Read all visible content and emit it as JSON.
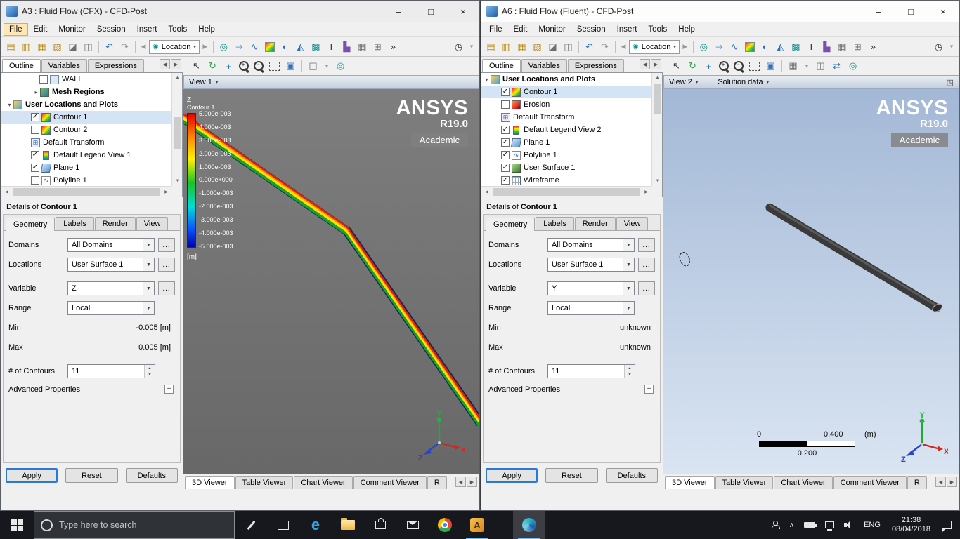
{
  "left_window": {
    "title": "A3 : Fluid Flow (CFX) - CFD-Post",
    "menu": [
      "File",
      "Edit",
      "Monitor",
      "Session",
      "Insert",
      "Tools",
      "Help"
    ],
    "toolbar": {
      "location_label": "Location"
    },
    "panel_tabs": [
      "Outline",
      "Variables",
      "Expressions"
    ],
    "tree": {
      "items": [
        {
          "label": "WALL"
        },
        {
          "label": "Mesh Regions"
        },
        {
          "label": "User Locations and Plots"
        },
        {
          "label": "Contour 1"
        },
        {
          "label": "Contour 2"
        },
        {
          "label": "Default Transform"
        },
        {
          "label": "Default Legend View 1"
        },
        {
          "label": "Plane 1"
        },
        {
          "label": "Polyline 1"
        }
      ]
    },
    "details": {
      "header_prefix": "Details of",
      "header_name": "Contour 1",
      "tabs": [
        "Geometry",
        "Labels",
        "Render",
        "View"
      ],
      "domains_label": "Domains",
      "domains_value": "All Domains",
      "locations_label": "Locations",
      "locations_value": "User Surface 1",
      "variable_label": "Variable",
      "variable_value": "Z",
      "range_label": "Range",
      "range_value": "Local",
      "min_label": "Min",
      "min_value": "-0.005 [m]",
      "max_label": "Max",
      "max_value": "0.005 [m]",
      "contours_label": "# of Contours",
      "contours_value": "11",
      "advanced_label": "Advanced Properties",
      "more_label": "...",
      "apply": "Apply",
      "reset": "Reset",
      "defaults": "Defaults"
    },
    "viewer": {
      "view_label": "View 1",
      "legend": {
        "variable": "Z",
        "name": "Contour 1",
        "values": [
          "5.000e-003",
          "4.000e-003",
          "3.000e-003",
          "2.000e-003",
          "1.000e-003",
          "0.000e+000",
          "-1.000e-003",
          "-2.000e-003",
          "-3.000e-003",
          "-4.000e-003",
          "-5.000e-003"
        ],
        "unit": "[m]"
      },
      "brand": {
        "name": "ANSYS",
        "version": "R19.0",
        "edition": "Academic"
      },
      "triad": {
        "x": "X",
        "y": "Y",
        "z": "Z"
      },
      "tabs": [
        "3D Viewer",
        "Table Viewer",
        "Chart Viewer",
        "Comment Viewer",
        "R"
      ]
    }
  },
  "right_window": {
    "title": "A6 : Fluid Flow (Fluent) - CFD-Post",
    "menu": [
      "File",
      "Edit",
      "Monitor",
      "Session",
      "Insert",
      "Tools",
      "Help"
    ],
    "toolbar": {
      "location_label": "Location"
    },
    "panel_tabs": [
      "Outline",
      "Variables",
      "Expressions"
    ],
    "tree": {
      "items": [
        {
          "label": "User Locations and Plots"
        },
        {
          "label": "Contour 1"
        },
        {
          "label": "Erosion"
        },
        {
          "label": "Default Transform"
        },
        {
          "label": "Default Legend View 2"
        },
        {
          "label": "Plane 1"
        },
        {
          "label": "Polyline 1"
        },
        {
          "label": "User Surface 1"
        },
        {
          "label": "Wireframe"
        }
      ]
    },
    "details": {
      "header_prefix": "Details of",
      "header_name": "Contour 1",
      "tabs": [
        "Geometry",
        "Labels",
        "Render",
        "View"
      ],
      "domains_label": "Domains",
      "domains_value": "All Domains",
      "locations_label": "Locations",
      "locations_value": "User Surface 1",
      "variable_label": "Variable",
      "variable_value": "Y",
      "range_label": "Range",
      "range_value": "Local",
      "min_label": "Min",
      "min_value": "unknown",
      "max_label": "Max",
      "max_value": "unknown",
      "contours_label": "# of Contours",
      "contours_value": "11",
      "advanced_label": "Advanced Properties",
      "more_label": "...",
      "apply": "Apply",
      "reset": "Reset",
      "defaults": "Defaults"
    },
    "viewer": {
      "view_label": "View 2",
      "data_label": "Solution data",
      "brand": {
        "name": "ANSYS",
        "version": "R19.0",
        "edition": "Academic"
      },
      "scale": {
        "zero": "0",
        "max": "0.400",
        "unit": "(m)",
        "mid": "0.200"
      },
      "triad": {
        "x": "X",
        "y": "Y",
        "z": "Z"
      },
      "tabs": [
        "3D Viewer",
        "Table Viewer",
        "Chart Viewer",
        "Comment Viewer",
        "R"
      ]
    }
  },
  "taskbar": {
    "search_placeholder": "Type here to search",
    "language": "ENG",
    "time": "21:38",
    "date": "08/04/2018"
  },
  "icons": {
    "minimize": "–",
    "maximize": "□",
    "close": "×",
    "doc_a": "▤",
    "doc_b": "▥",
    "doc_c": "▦",
    "doc_d": "▧",
    "snapshot": "◪",
    "copy": "◫",
    "undo": "↶",
    "redo": "↷",
    "back": "◀",
    "forward": "▶",
    "dropdown": "▼",
    "caret": "▾",
    "pin": "◉",
    "probe": "◎",
    "vector": "⇒",
    "streamline": "∿",
    "isosurface": "◐",
    "slice": "◭",
    "volume": "▩",
    "text": "T",
    "chart": "▙",
    "table": "▦",
    "calc": "⊞",
    "overflow": "»",
    "clock": "◷",
    "select": "↖",
    "orbit": "↻",
    "pan": "+",
    "fit": "▣",
    "viewport": "◫",
    "grid": "▦",
    "sync": "⇄",
    "layout": "◳",
    "expand_open": "▾",
    "expand_closed": "▸",
    "check": "✓",
    "plus": "+",
    "up": "▲",
    "down": "▼",
    "transform_glyph": "⊞",
    "polyline_glyph": "∿",
    "chevron_up": "∧",
    "edge": "e",
    "ansys": "A"
  }
}
